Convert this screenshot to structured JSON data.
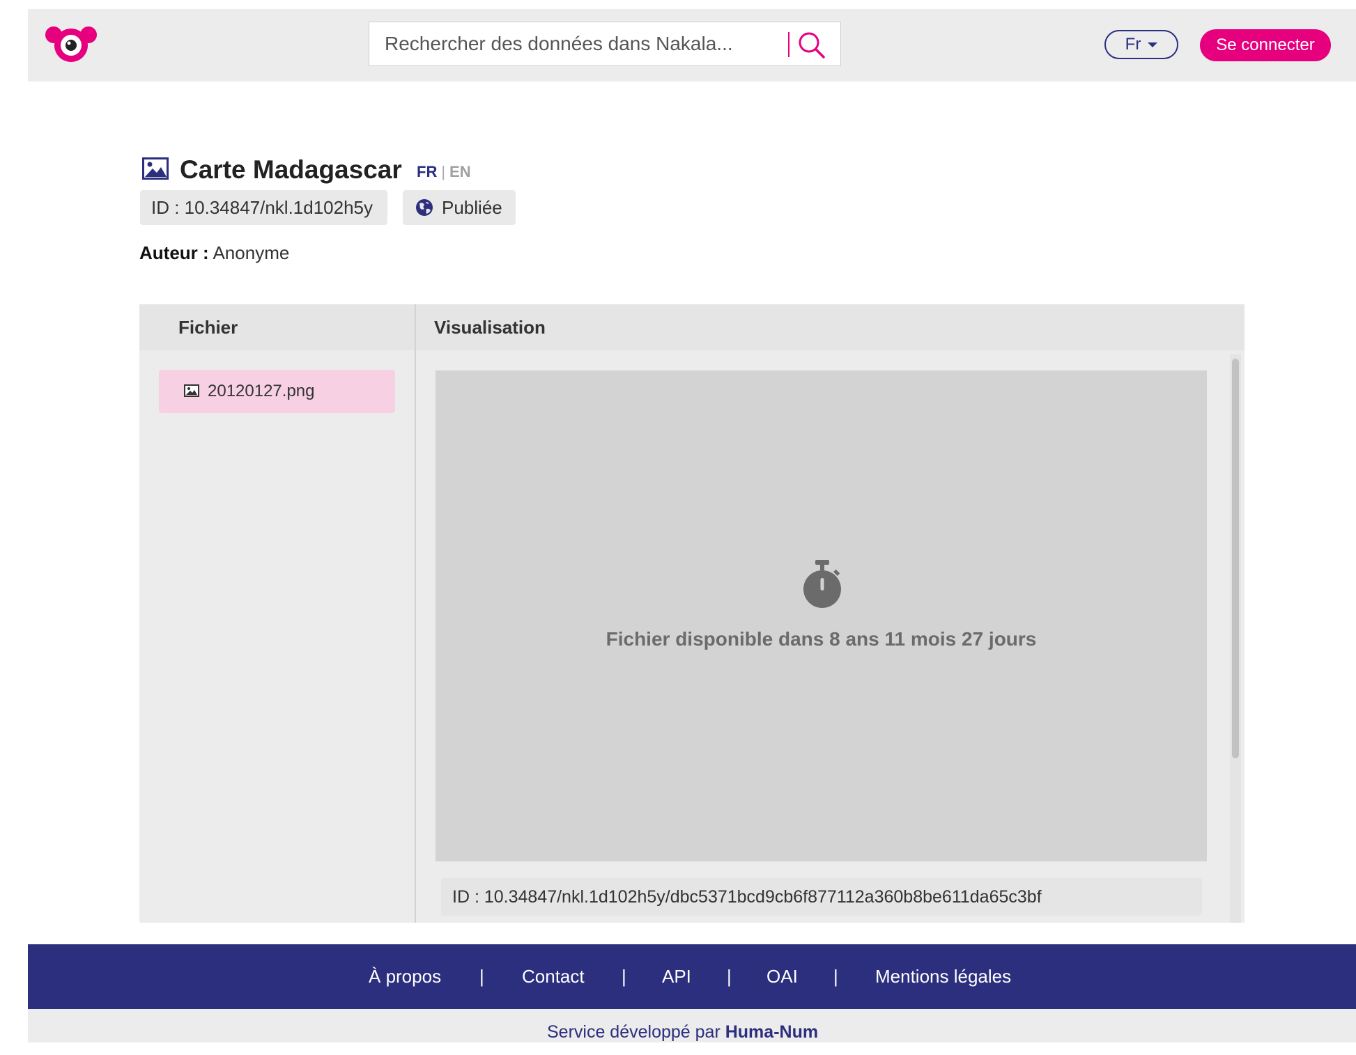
{
  "header": {
    "search_placeholder": "Rechercher des données dans Nakala...",
    "lang_label": "Fr",
    "login_label": "Se connecter"
  },
  "data": {
    "title": "Carte Madagascar",
    "lang_fr": "FR",
    "lang_sep": "|",
    "lang_en": "EN",
    "id": "ID : 10.34847/nkl.1d102h5y",
    "status": "Publiée",
    "author_label": "Auteur :",
    "author_value": "Anonyme"
  },
  "panel": {
    "files_header": "Fichier",
    "viewer_header": "Visualisation",
    "files": [
      {
        "name": "20120127.png"
      }
    ],
    "viewer_message": "Fichier disponible dans 8 ans 11 mois 27 jours",
    "file_id": "ID : 10.34847/nkl.1d102h5y/dbc5371bcd9cb6f877112a360b8be611da65c3bf"
  },
  "footer": {
    "links": [
      "À propos",
      "Contact",
      "API",
      "OAI",
      "Mentions légales"
    ],
    "separator": "|",
    "credit_prefix": "Service développé par",
    "credit_name": "Huma-Num"
  },
  "colors": {
    "accent": "#e6007e",
    "primary": "#2c2e7e",
    "navbar_bg": "#ececec",
    "selected_file_bg": "#f8d0e4",
    "viewer_bg": "#d3d3d3"
  },
  "icons": {
    "logo": "nakala-logo",
    "search": "search-icon",
    "title": "image-icon",
    "status": "globe-icon",
    "file": "image-file-icon",
    "viewer": "stopwatch-icon"
  }
}
